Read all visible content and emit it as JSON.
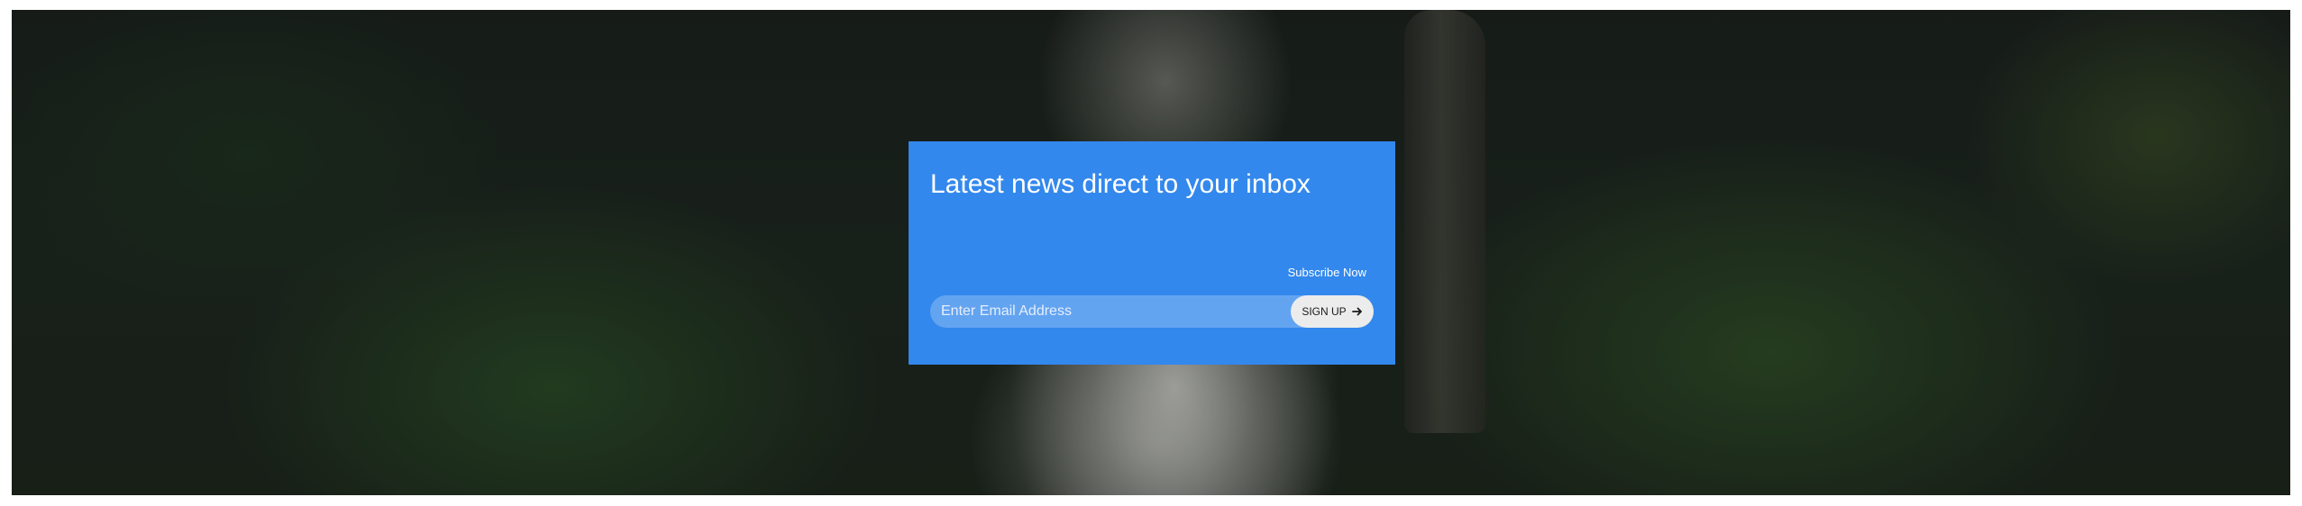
{
  "newsletter": {
    "title": "Latest news direct to your inbox",
    "subtitle": "Subscribe Now",
    "email_placeholder": "Enter Email Address",
    "email_value": "",
    "signup_label": "SIGN UP",
    "signup_icon": "arrow-right-icon"
  },
  "colors": {
    "card_background": "#3388ed",
    "button_background": "#ececec",
    "text": "#ffffff"
  }
}
